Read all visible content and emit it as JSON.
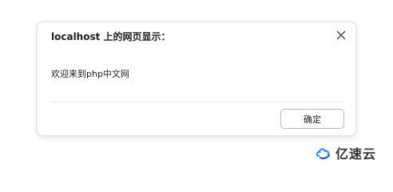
{
  "dialog": {
    "title": "localhost 上的网页显示：",
    "message": "欢迎来到php中文网",
    "ok_label": "确定"
  },
  "watermark": {
    "text": "亿速云",
    "logo_icon": "cloud-logo-icon"
  },
  "colors": {
    "text": "#202124",
    "border": "#e6e6e6",
    "button_border": "#b9b9b9",
    "watermark_blue": "#2d8cf0"
  }
}
